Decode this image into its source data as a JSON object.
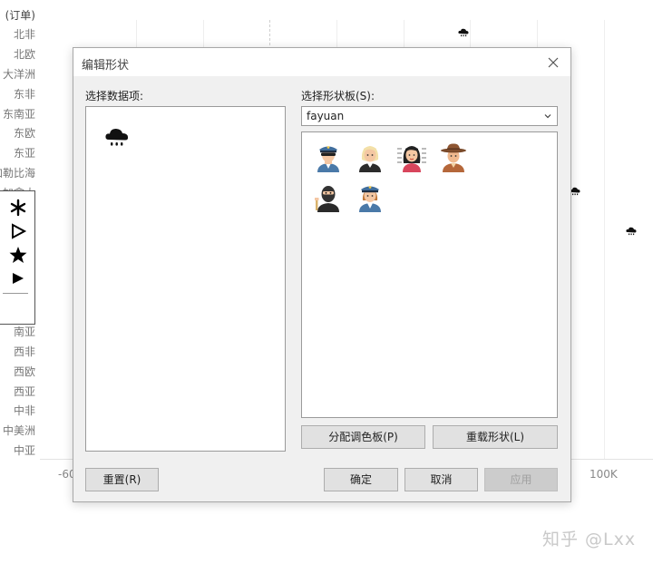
{
  "background_chart": {
    "row_header": "(订单)",
    "rows": [
      "北非",
      "北欧",
      "大洋洲",
      "东非",
      "东南亚",
      "东欧",
      "东亚",
      "加勒比海",
      "加拿大",
      "",
      "",
      "",
      "",
      "",
      "南亚",
      "西非",
      "西欧",
      "西亚",
      "中非",
      "中美洲",
      "中亚"
    ],
    "ticks": [
      {
        "label": "-60"
      },
      {
        "label": "100K"
      }
    ],
    "legend_shapes": [
      "asterisk-shape",
      "triangle-right-outline-shape",
      "star-shape",
      "triangle-right-filled-shape"
    ],
    "mark_icon": "rain-cloud-icon"
  },
  "dialog": {
    "title": "编辑形状",
    "data_items_label": "选择数据项:",
    "data_items": [
      {
        "icon": "rain-cloud-icon"
      }
    ],
    "palette_label": "选择形状板(S):",
    "palette_value": "fayuan",
    "shapes": [
      {
        "icon": "police-officer-sunglasses-icon"
      },
      {
        "icon": "blonde-woman-icon"
      },
      {
        "icon": "woman-mugshot-icon"
      },
      {
        "icon": "cowboy-icon"
      },
      {
        "icon": "masked-criminal-icon"
      },
      {
        "icon": "policewoman-icon"
      }
    ],
    "buttons": {
      "assign_palette": "分配调色板(P)",
      "reload_shapes": "重载形状(L)",
      "reset": "重置(R)",
      "ok": "确定",
      "cancel": "取消",
      "apply": "应用"
    }
  },
  "watermark": "知乎 @Lxx",
  "colors": {
    "dialog_bg": "#f0f0f0",
    "button_bg": "#e1e1e1",
    "button_disabled_bg": "#cccccc",
    "police_blue": "#4a79a8",
    "skin": "#f4c7a3"
  }
}
